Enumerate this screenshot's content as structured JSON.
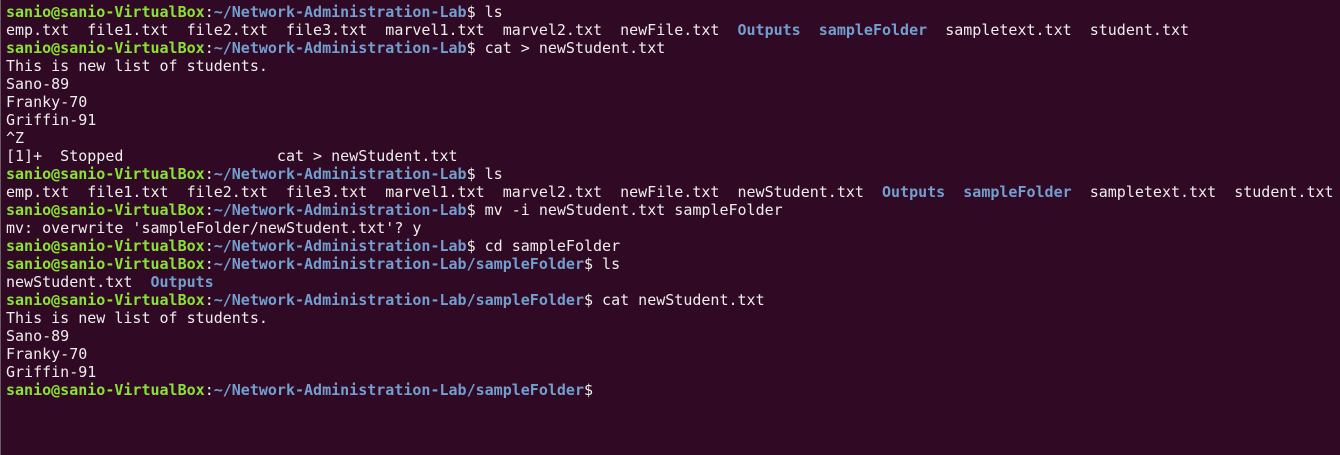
{
  "terminal": {
    "lines": [
      [
        {
          "t": "sanio@sanio-VirtualBox",
          "c": "prompt-user"
        },
        {
          "t": ":",
          "c": "prompt-sep"
        },
        {
          "t": "~/Network-Administration-Lab",
          "c": "prompt-path"
        },
        {
          "t": "$ ls",
          "c": "out"
        }
      ],
      [
        {
          "t": "emp.txt  file1.txt  file2.txt  file3.txt  marvel1.txt  marvel2.txt  newFile.txt  ",
          "c": "out"
        },
        {
          "t": "Outputs",
          "c": "dir"
        },
        {
          "t": "  ",
          "c": "out"
        },
        {
          "t": "sampleFolder",
          "c": "dir"
        },
        {
          "t": "  sampletext.txt  student.txt",
          "c": "out"
        }
      ],
      [
        {
          "t": "sanio@sanio-VirtualBox",
          "c": "prompt-user"
        },
        {
          "t": ":",
          "c": "prompt-sep"
        },
        {
          "t": "~/Network-Administration-Lab",
          "c": "prompt-path"
        },
        {
          "t": "$ cat > newStudent.txt",
          "c": "out"
        }
      ],
      [
        {
          "t": "This is new list of students.",
          "c": "out"
        }
      ],
      [
        {
          "t": "Sano-89",
          "c": "out"
        }
      ],
      [
        {
          "t": "Franky-70",
          "c": "out"
        }
      ],
      [
        {
          "t": "Griffin-91",
          "c": "out"
        }
      ],
      [
        {
          "t": "^Z",
          "c": "out"
        }
      ],
      [
        {
          "t": "[1]+  Stopped                 cat > newStudent.txt",
          "c": "out"
        }
      ],
      [
        {
          "t": "sanio@sanio-VirtualBox",
          "c": "prompt-user"
        },
        {
          "t": ":",
          "c": "prompt-sep"
        },
        {
          "t": "~/Network-Administration-Lab",
          "c": "prompt-path"
        },
        {
          "t": "$ ls",
          "c": "out"
        }
      ],
      [
        {
          "t": "emp.txt  file1.txt  file2.txt  file3.txt  marvel1.txt  marvel2.txt  newFile.txt  newStudent.txt  ",
          "c": "out"
        },
        {
          "t": "Outputs",
          "c": "dir"
        },
        {
          "t": "  ",
          "c": "out"
        },
        {
          "t": "sampleFolder",
          "c": "dir"
        },
        {
          "t": "  sampletext.txt  student.txt",
          "c": "out"
        }
      ],
      [
        {
          "t": "sanio@sanio-VirtualBox",
          "c": "prompt-user"
        },
        {
          "t": ":",
          "c": "prompt-sep"
        },
        {
          "t": "~/Network-Administration-Lab",
          "c": "prompt-path"
        },
        {
          "t": "$ mv -i newStudent.txt sampleFolder",
          "c": "out"
        }
      ],
      [
        {
          "t": "mv: overwrite 'sampleFolder/newStudent.txt'? y",
          "c": "out"
        }
      ],
      [
        {
          "t": "sanio@sanio-VirtualBox",
          "c": "prompt-user"
        },
        {
          "t": ":",
          "c": "prompt-sep"
        },
        {
          "t": "~/Network-Administration-Lab",
          "c": "prompt-path"
        },
        {
          "t": "$ cd sampleFolder",
          "c": "out"
        }
      ],
      [
        {
          "t": "sanio@sanio-VirtualBox",
          "c": "prompt-user"
        },
        {
          "t": ":",
          "c": "prompt-sep"
        },
        {
          "t": "~/Network-Administration-Lab/sampleFolder",
          "c": "prompt-path"
        },
        {
          "t": "$ ls",
          "c": "out"
        }
      ],
      [
        {
          "t": "newStudent.txt  ",
          "c": "out"
        },
        {
          "t": "Outputs",
          "c": "dir"
        }
      ],
      [
        {
          "t": "sanio@sanio-VirtualBox",
          "c": "prompt-user"
        },
        {
          "t": ":",
          "c": "prompt-sep"
        },
        {
          "t": "~/Network-Administration-Lab/sampleFolder",
          "c": "prompt-path"
        },
        {
          "t": "$ cat newStudent.txt",
          "c": "out"
        }
      ],
      [
        {
          "t": "This is new list of students.",
          "c": "out"
        }
      ],
      [
        {
          "t": "Sano-89",
          "c": "out"
        }
      ],
      [
        {
          "t": "Franky-70",
          "c": "out"
        }
      ],
      [
        {
          "t": "Griffin-91",
          "c": "out"
        }
      ],
      [
        {
          "t": "sanio@sanio-VirtualBox",
          "c": "prompt-user"
        },
        {
          "t": ":",
          "c": "prompt-sep"
        },
        {
          "t": "~/Network-Administration-Lab/sampleFolder",
          "c": "prompt-path"
        },
        {
          "t": "$",
          "c": "out"
        }
      ]
    ]
  },
  "colors": {
    "background": "#300a24",
    "text": "#eeeeec",
    "prompt_user": "#8ae234",
    "prompt_path": "#729fcf",
    "directory": "#729fcf"
  }
}
